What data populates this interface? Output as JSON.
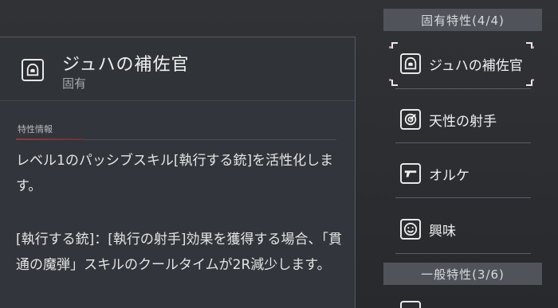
{
  "detail": {
    "title": "ジュハの補佐官",
    "subtitle": "固有",
    "section_label": "特性情報",
    "description_1": "レベル1のパッシブスキル[執行する銃]を活性化します。",
    "description_2": "[執行する銃]：[執行の射手]効果を獲得する場合、「貫通の魔弾」スキルのクールタイムが2R減少します。",
    "icon": "hooded-figure-icon"
  },
  "trait_list": {
    "unique_header": "固有特性(4/4)",
    "general_header": "一般特性(3/6)",
    "items": [
      {
        "label": "ジュハの補佐官",
        "icon": "hooded-figure-icon",
        "selected": true
      },
      {
        "label": "天性の射手",
        "icon": "target-icon",
        "selected": false
      },
      {
        "label": "オルケ",
        "icon": "gun-icon",
        "selected": false
      },
      {
        "label": "興味",
        "icon": "smiley-icon",
        "selected": false
      }
    ]
  },
  "colors": {
    "background": "#2b2d31",
    "panel": "#32353b",
    "group_header": "#50545a",
    "accent_line": "#8f3b3b",
    "selection_dot": "#d9a0b4"
  }
}
